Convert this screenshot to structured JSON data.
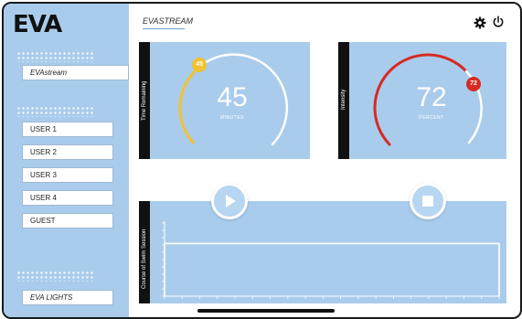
{
  "app": {
    "logo": "EVA"
  },
  "header": {
    "title": "EVASTREAM"
  },
  "sidebar": {
    "active_item": "EVAstream",
    "users": [
      "USER 1",
      "USER 2",
      "USER 3",
      "USER 4",
      "GUEST"
    ],
    "bottom_button": "EVA LIGHTS"
  },
  "cards": {
    "time": {
      "label": "Time Remaining",
      "value": "45",
      "unit": "MINUTES",
      "badge": "45",
      "accent": "#f2c230",
      "progress": 0.45
    },
    "intensity": {
      "label": "Intensity",
      "value": "72",
      "unit": "PERCENT",
      "badge": "72",
      "accent": "#d62a22",
      "progress": 0.72
    }
  },
  "controls": {
    "play_icon": "play-icon",
    "stop_icon": "stop-icon"
  },
  "chart_data": {
    "type": "line",
    "ylabel": "Course of Swim Session",
    "x": [
      0,
      1,
      2,
      3,
      4,
      5,
      6,
      7,
      8,
      9,
      10,
      11,
      12,
      13,
      14,
      15,
      16,
      17,
      18,
      19
    ],
    "series": [
      {
        "values": [
          72,
          72,
          72,
          72,
          72,
          72,
          72,
          72,
          72,
          72,
          72,
          72,
          72,
          72,
          72,
          72,
          72,
          72,
          72,
          72
        ]
      }
    ],
    "ylim": [
      0,
      100
    ],
    "grid": false
  }
}
